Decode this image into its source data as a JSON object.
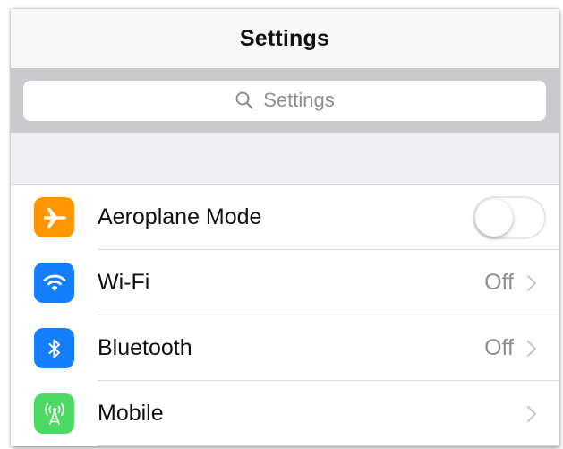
{
  "header": {
    "title": "Settings"
  },
  "search": {
    "placeholder": "Settings",
    "icon": "search-icon"
  },
  "rows": [
    {
      "label": "Aeroplane Mode",
      "icon": "airplane-icon",
      "icon_color": "#ff9500",
      "control": "toggle",
      "toggle_on": false
    },
    {
      "label": "Wi-Fi",
      "icon": "wifi-icon",
      "icon_color": "#147efb",
      "value": "Off",
      "control": "chevron"
    },
    {
      "label": "Bluetooth",
      "icon": "bluetooth-icon",
      "icon_color": "#147efb",
      "value": "Off",
      "control": "chevron"
    },
    {
      "label": "Mobile",
      "icon": "antenna-icon",
      "icon_color": "#4cd964",
      "value": "",
      "control": "chevron"
    }
  ],
  "colors": {
    "search_bar_bg": "#c9c9ce",
    "group_bg": "#efeff4",
    "secondary_text": "#8e8e93"
  }
}
